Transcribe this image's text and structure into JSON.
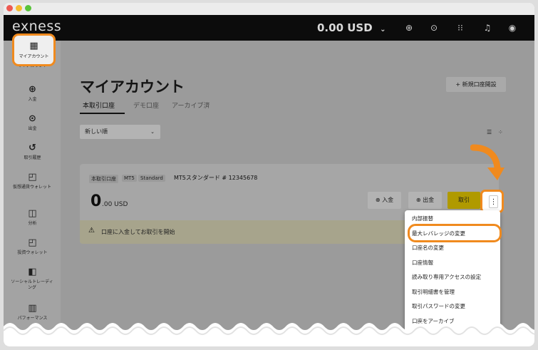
{
  "window": {
    "dots": [
      "#ee5a52",
      "#f5bd30",
      "#59c43a"
    ]
  },
  "topbar": {
    "logo": "exness",
    "balance": "0.00 USD",
    "balance_chevron": "⌄",
    "icons": [
      "globe-icon",
      "help-icon",
      "apps-grid-icon",
      "bell-icon",
      "user-icon"
    ]
  },
  "sidebar": {
    "items": [
      {
        "icon": "dashboard-icon",
        "glyph": "▦",
        "label": "マイアカウント"
      },
      {
        "icon": "deposit-icon",
        "glyph": "⊕",
        "label": "入金"
      },
      {
        "icon": "withdraw-icon",
        "glyph": "⊙",
        "label": "出金"
      },
      {
        "icon": "history-icon",
        "glyph": "↺",
        "label": "取引履歴"
      },
      {
        "icon": "wallet-icon",
        "glyph": "◰",
        "label": "仮想通貨ウォレット"
      },
      {
        "icon": "analytics-icon",
        "glyph": "◫",
        "label": "分析"
      },
      {
        "icon": "invest-wallet-icon",
        "glyph": "◰",
        "label": "投資ウォレット"
      },
      {
        "icon": "social-trading-icon",
        "glyph": "◧",
        "label": "ソーシャルトレーディング"
      },
      {
        "icon": "performance-icon",
        "glyph": "▥",
        "label": "パフォーマンス"
      }
    ]
  },
  "main": {
    "title": "マイアカウント",
    "new_account_button": "+ 新規口座開設",
    "tabs": [
      {
        "label": "本取引口座",
        "active": true
      },
      {
        "label": "デモ口座",
        "active": false
      },
      {
        "label": "アーカイブ済",
        "active": false
      }
    ],
    "sort": {
      "value": "新しい順",
      "chevron": "⌄"
    },
    "view_icons": [
      "list-view-icon",
      "grid-view-icon"
    ]
  },
  "account_card": {
    "tags": [
      "本取引口座",
      "MT5",
      "Standard"
    ],
    "name": "MT5スタンダード # 12345678",
    "balance_int": "0",
    "balance_rest": ".00 USD",
    "buttons": {
      "deposit": "⊕ 入金",
      "withdraw": "⊕ 出金",
      "trade": "取引",
      "more": "⋮"
    },
    "banner": "口座に入金してお取引を開始",
    "banner_icon": "⚠"
  },
  "menu": {
    "items": [
      "内部振替",
      "最大レバレッジの変更",
      "口座名の変更",
      "口座情報",
      "読み取り専用アクセスの設定",
      "取引明細書を管理",
      "取引パスワードの変更",
      "口座をアーカイブ"
    ]
  },
  "colors": {
    "accent": "#f08a1e",
    "trade": "#b09a00",
    "banner": "#a7a48c"
  }
}
